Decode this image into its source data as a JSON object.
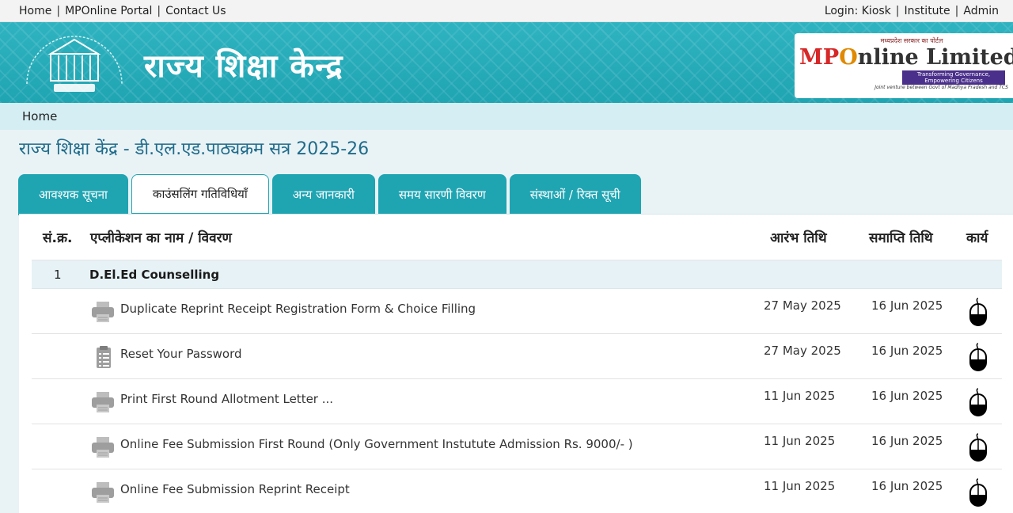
{
  "topbar": {
    "left_links": [
      "Home",
      "MPOnline Portal",
      "Contact Us"
    ],
    "right_links": [
      "Login: Kiosk",
      "Institute",
      "Admin"
    ]
  },
  "banner": {
    "title": "राज्य शिक्षा केन्द्र",
    "logo": {
      "top_text": "मध्यप्रदेश सरकार का पोर्टल",
      "mp": "MP",
      "o": "O",
      "rest": "nline Limited",
      "tagline": "Transforming Governance, Empowering Citizens",
      "subline": "Joint venture between Govt of Madhya Pradesh and TCS"
    }
  },
  "breadcrumb": "Home",
  "page_title": "राज्य शिक्षा केंद्र - डी.एल.एड.पाठ्यक्रम सत्र 2025-26",
  "tabs": [
    {
      "label": "आवश्यक सूचना",
      "active": false
    },
    {
      "label": "काउंसलिंग गतिविधियाँ",
      "active": true
    },
    {
      "label": "अन्य जानकारी",
      "active": false
    },
    {
      "label": "समय सारणी विवरण",
      "active": false
    },
    {
      "label": "संस्थाओं / रिक्त सूची",
      "active": false
    }
  ],
  "table": {
    "headers": {
      "no": "सं.क्र.",
      "name": "एप्लीकेशन का नाम / विवरण",
      "start": "आरंभ तिथि",
      "end": "समाप्ति तिथि",
      "action": "कार्य"
    },
    "group": {
      "no": "1",
      "name": "D.El.Ed Counselling"
    },
    "rows": [
      {
        "icon": "printer-icon",
        "name": "Duplicate Reprint Receipt Registration Form & Choice Filling",
        "start": "27 May 2025",
        "end": "16 Jun 2025"
      },
      {
        "icon": "clipboard-icon",
        "name": "Reset Your Password",
        "start": "27 May 2025",
        "end": "16 Jun 2025"
      },
      {
        "icon": "printer-icon",
        "name": "Print First Round Allotment Letter ...",
        "start": "11 Jun 2025",
        "end": "16 Jun 2025"
      },
      {
        "icon": "printer-icon",
        "name": "Online Fee Submission First Round (Only Government Instutute Admission Rs. 9000/- )",
        "start": "11 Jun 2025",
        "end": "16 Jun 2025"
      },
      {
        "icon": "printer-icon",
        "name": "Online Fee Submission Reprint Receipt",
        "start": "11 Jun 2025",
        "end": "16 Jun 2025"
      }
    ]
  },
  "colors": {
    "teal": "#1fa4b2",
    "title_blue": "#1f6b8a",
    "light_band": "#d4eef3"
  }
}
